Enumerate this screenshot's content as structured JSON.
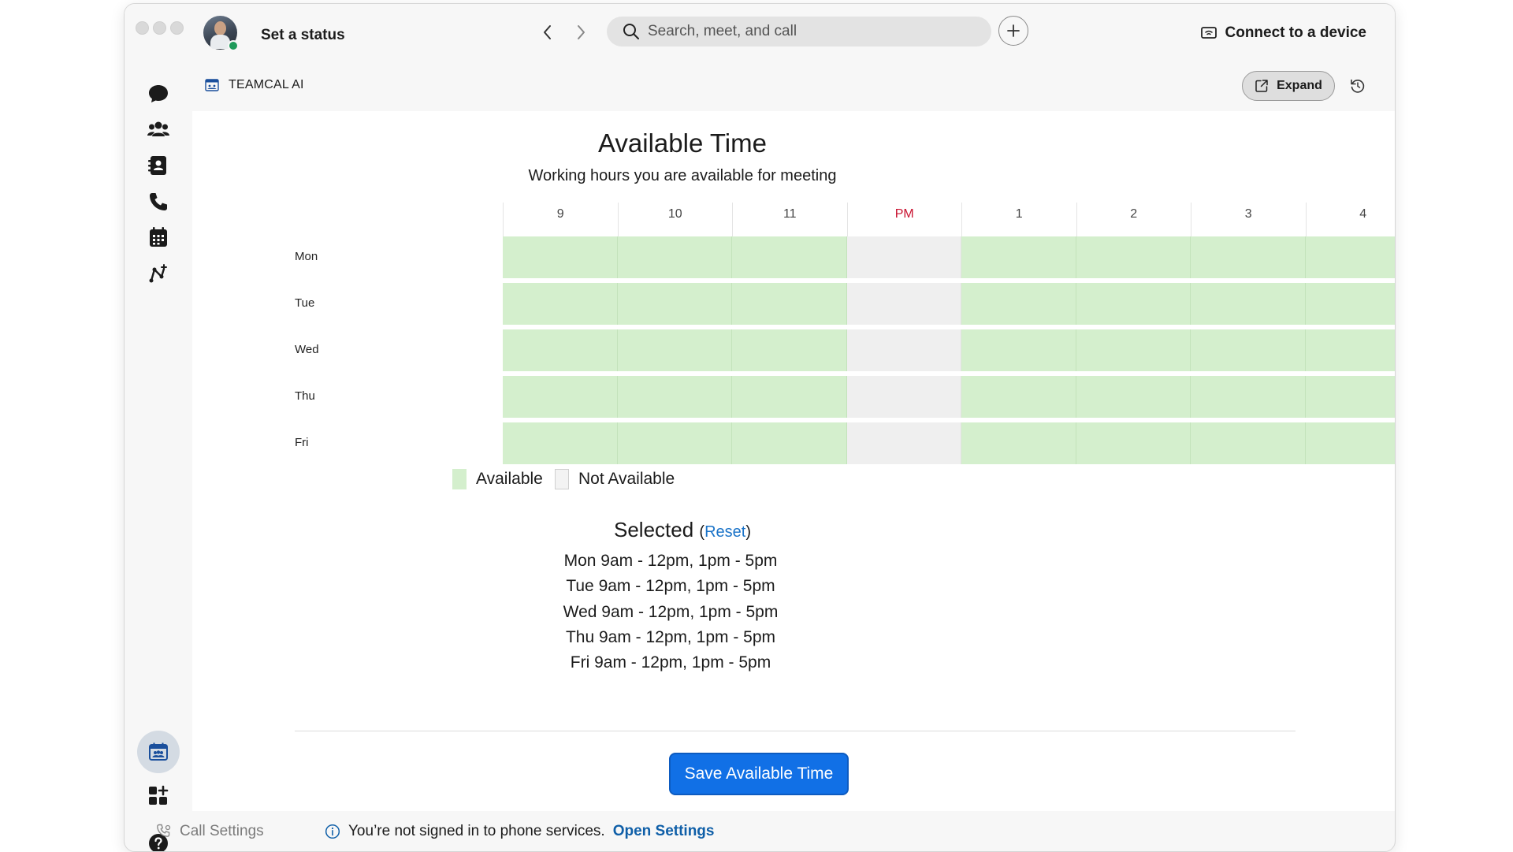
{
  "titlebar": {
    "status_text": "Set a status",
    "search_placeholder": "Search, meet, and call",
    "connect_label": "Connect to a device"
  },
  "rail": {
    "items": [
      {
        "name": "messaging-icon"
      },
      {
        "name": "teams-icon"
      },
      {
        "name": "contacts-icon"
      },
      {
        "name": "calling-icon"
      },
      {
        "name": "calendar-icon"
      },
      {
        "name": "workflows-icon"
      }
    ],
    "active_app": "teamcal-app-icon",
    "call_settings_label": "Call Settings"
  },
  "panel": {
    "app_title": "TEAMCAL AI",
    "expand_label": "Expand",
    "heading": "Available Time",
    "subheading": "Working hours you are available for meeting"
  },
  "grid": {
    "columns": [
      "9",
      "10",
      "11",
      "PM",
      "1",
      "2",
      "3",
      "4"
    ],
    "days": [
      "Mon",
      "Tue",
      "Wed",
      "Thu",
      "Fri"
    ],
    "availability": [
      [
        true,
        true,
        true,
        false,
        true,
        true,
        true,
        true
      ],
      [
        true,
        true,
        true,
        false,
        true,
        true,
        true,
        true
      ],
      [
        true,
        true,
        true,
        false,
        true,
        true,
        true,
        true
      ],
      [
        true,
        true,
        true,
        false,
        true,
        true,
        true,
        true
      ],
      [
        true,
        true,
        true,
        false,
        true,
        true,
        true,
        true
      ]
    ]
  },
  "legend": {
    "available": "Available",
    "not_available": "Not Available"
  },
  "selected": {
    "title": "Selected",
    "open_paren": "(",
    "reset": "Reset",
    "close_paren": ")",
    "lines": [
      "Mon 9am - 12pm, 1pm - 5pm",
      "Tue 9am - 12pm, 1pm - 5pm",
      "Wed 9am - 12pm, 1pm - 5pm",
      "Thu 9am - 12pm, 1pm - 5pm",
      "Fri 9am - 12pm, 1pm - 5pm"
    ]
  },
  "actions": {
    "save_label": "Save Available Time"
  },
  "footer": {
    "notice": "You’re not signed in to phone services.",
    "link": "Open Settings"
  },
  "colors": {
    "available": "#d4efcd",
    "not_available": "#efefef",
    "pm_label": "#c8102e",
    "primary": "#1170e6",
    "link": "#1a73c8"
  }
}
